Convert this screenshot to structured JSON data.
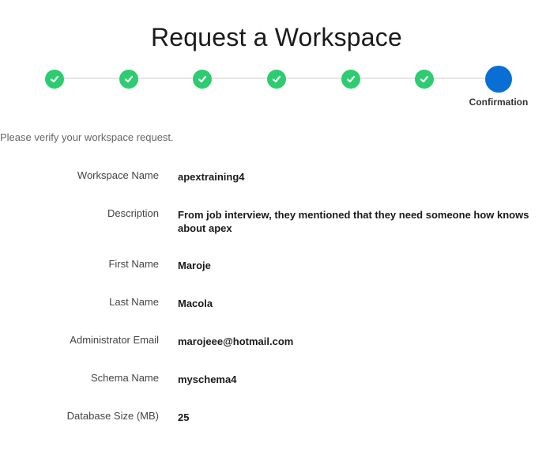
{
  "page": {
    "title": "Request a Workspace",
    "intro": "Please verify your workspace request."
  },
  "wizard": {
    "completed_steps": 6,
    "current_step_label": "Confirmation",
    "colors": {
      "completed": "#2ecc71",
      "current": "#0a6fd4"
    }
  },
  "fields": {
    "workspace_name": {
      "label": "Workspace Name",
      "value": "apextraining4"
    },
    "description": {
      "label": "Description",
      "value": "From job interview, they mentioned that they need someone how knows about apex"
    },
    "first_name": {
      "label": "First Name",
      "value": "Maroje"
    },
    "last_name": {
      "label": "Last Name",
      "value": "Macola"
    },
    "admin_email": {
      "label": "Administrator Email",
      "value": "marojeee@hotmail.com"
    },
    "schema_name": {
      "label": "Schema Name",
      "value": "myschema4"
    },
    "database_size": {
      "label": "Database Size (MB)",
      "value": "25"
    }
  }
}
